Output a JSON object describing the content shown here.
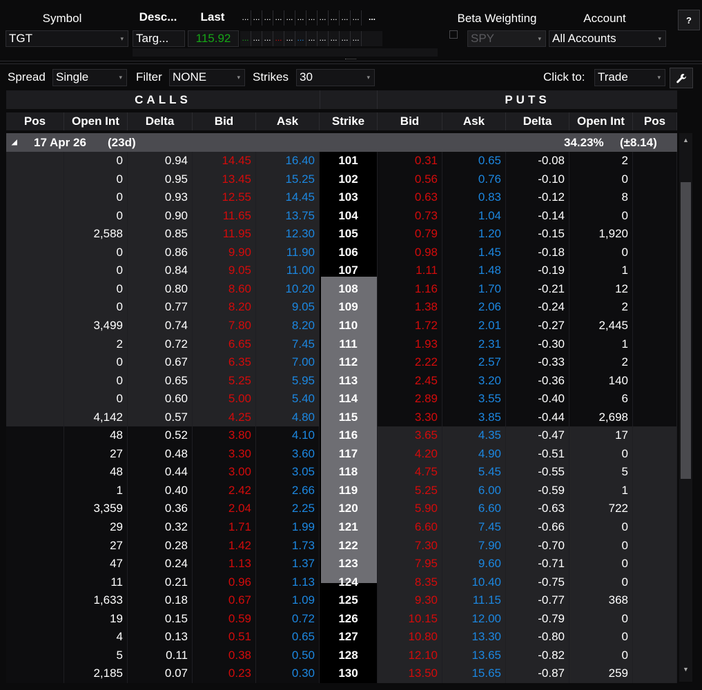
{
  "header": {
    "symbol_label": "Symbol",
    "symbol_value": "TGT",
    "desc_label": "Desc...",
    "desc_value": "Targ...",
    "last_label": "Last",
    "last_value": "115.92",
    "ellipsis": "...",
    "beta_label": "Beta Weighting",
    "beta_value": "SPY",
    "account_label": "Account",
    "account_value": "All Accounts",
    "help_label": "?"
  },
  "toolbar": {
    "spread_label": "Spread",
    "spread_value": "Single",
    "filter_label": "Filter",
    "filter_value": "NONE",
    "strikes_label": "Strikes",
    "strikes_value": "30",
    "clickto_label": "Click to:",
    "clickto_value": "Trade"
  },
  "sections": {
    "calls": "CALLS",
    "puts": "PUTS"
  },
  "columns": [
    "Pos",
    "Open Int",
    "Delta",
    "Bid",
    "Ask",
    "Strike",
    "Bid",
    "Ask",
    "Delta",
    "Open Int",
    "Pos"
  ],
  "expiry": {
    "date": "17 Apr 26",
    "dte": "(23d)",
    "iv": "34.23%",
    "move": "(±8.14)"
  },
  "rows": [
    {
      "coi": "0",
      "cdelta": "0.94",
      "cbid": "14.45",
      "cask": "16.40",
      "strike": "101",
      "pbid": "0.31",
      "pask": "0.65",
      "pdelta": "-0.08",
      "poi": "2"
    },
    {
      "coi": "0",
      "cdelta": "0.95",
      "cbid": "13.45",
      "cask": "15.25",
      "strike": "102",
      "pbid": "0.56",
      "pask": "0.76",
      "pdelta": "-0.10",
      "poi": "0"
    },
    {
      "coi": "0",
      "cdelta": "0.93",
      "cbid": "12.55",
      "cask": "14.45",
      "strike": "103",
      "pbid": "0.63",
      "pask": "0.83",
      "pdelta": "-0.12",
      "poi": "8"
    },
    {
      "coi": "0",
      "cdelta": "0.90",
      "cbid": "11.65",
      "cask": "13.75",
      "strike": "104",
      "pbid": "0.73",
      "pask": "1.04",
      "pdelta": "-0.14",
      "poi": "0"
    },
    {
      "coi": "2,588",
      "cdelta": "0.85",
      "cbid": "11.95",
      "cask": "12.30",
      "strike": "105",
      "pbid": "0.79",
      "pask": "1.20",
      "pdelta": "-0.15",
      "poi": "1,920"
    },
    {
      "coi": "0",
      "cdelta": "0.86",
      "cbid": "9.90",
      "cask": "11.90",
      "strike": "106",
      "pbid": "0.98",
      "pask": "1.45",
      "pdelta": "-0.18",
      "poi": "0"
    },
    {
      "coi": "0",
      "cdelta": "0.84",
      "cbid": "9.05",
      "cask": "11.00",
      "strike": "107",
      "pbid": "1.11",
      "pask": "1.48",
      "pdelta": "-0.19",
      "poi": "1"
    },
    {
      "coi": "0",
      "cdelta": "0.80",
      "cbid": "8.60",
      "cask": "10.20",
      "strike": "108",
      "pbid": "1.16",
      "pask": "1.70",
      "pdelta": "-0.21",
      "poi": "12"
    },
    {
      "coi": "0",
      "cdelta": "0.77",
      "cbid": "8.20",
      "cask": "9.05",
      "strike": "109",
      "pbid": "1.38",
      "pask": "2.06",
      "pdelta": "-0.24",
      "poi": "2"
    },
    {
      "coi": "3,499",
      "cdelta": "0.74",
      "cbid": "7.80",
      "cask": "8.20",
      "strike": "110",
      "pbid": "1.72",
      "pask": "2.01",
      "pdelta": "-0.27",
      "poi": "2,445"
    },
    {
      "coi": "2",
      "cdelta": "0.72",
      "cbid": "6.65",
      "cask": "7.45",
      "strike": "111",
      "pbid": "1.93",
      "pask": "2.31",
      "pdelta": "-0.30",
      "poi": "1"
    },
    {
      "coi": "0",
      "cdelta": "0.67",
      "cbid": "6.35",
      "cask": "7.00",
      "strike": "112",
      "pbid": "2.22",
      "pask": "2.57",
      "pdelta": "-0.33",
      "poi": "2"
    },
    {
      "coi": "0",
      "cdelta": "0.65",
      "cbid": "5.25",
      "cask": "5.95",
      "strike": "113",
      "pbid": "2.45",
      "pask": "3.20",
      "pdelta": "-0.36",
      "poi": "140"
    },
    {
      "coi": "0",
      "cdelta": "0.60",
      "cbid": "5.00",
      "cask": "5.40",
      "strike": "114",
      "pbid": "2.89",
      "pask": "3.55",
      "pdelta": "-0.40",
      "poi": "6"
    },
    {
      "coi": "4,142",
      "cdelta": "0.57",
      "cbid": "4.25",
      "cask": "4.80",
      "strike": "115",
      "pbid": "3.30",
      "pask": "3.85",
      "pdelta": "-0.44",
      "poi": "2,698"
    },
    {
      "coi": "48",
      "cdelta": "0.52",
      "cbid": "3.80",
      "cask": "4.10",
      "strike": "116",
      "pbid": "3.65",
      "pask": "4.35",
      "pdelta": "-0.47",
      "poi": "17"
    },
    {
      "coi": "27",
      "cdelta": "0.48",
      "cbid": "3.30",
      "cask": "3.60",
      "strike": "117",
      "pbid": "4.20",
      "pask": "4.90",
      "pdelta": "-0.51",
      "poi": "0"
    },
    {
      "coi": "48",
      "cdelta": "0.44",
      "cbid": "3.00",
      "cask": "3.05",
      "strike": "118",
      "pbid": "4.75",
      "pask": "5.45",
      "pdelta": "-0.55",
      "poi": "5"
    },
    {
      "coi": "1",
      "cdelta": "0.40",
      "cbid": "2.42",
      "cask": "2.66",
      "strike": "119",
      "pbid": "5.25",
      "pask": "6.00",
      "pdelta": "-0.59",
      "poi": "1"
    },
    {
      "coi": "3,359",
      "cdelta": "0.36",
      "cbid": "2.04",
      "cask": "2.25",
      "strike": "120",
      "pbid": "5.90",
      "pask": "6.60",
      "pdelta": "-0.63",
      "poi": "722"
    },
    {
      "coi": "29",
      "cdelta": "0.32",
      "cbid": "1.71",
      "cask": "1.99",
      "strike": "121",
      "pbid": "6.60",
      "pask": "7.45",
      "pdelta": "-0.66",
      "poi": "0"
    },
    {
      "coi": "27",
      "cdelta": "0.28",
      "cbid": "1.42",
      "cask": "1.73",
      "strike": "122",
      "pbid": "7.30",
      "pask": "7.90",
      "pdelta": "-0.70",
      "poi": "0"
    },
    {
      "coi": "47",
      "cdelta": "0.24",
      "cbid": "1.13",
      "cask": "1.37",
      "strike": "123",
      "pbid": "7.95",
      "pask": "9.60",
      "pdelta": "-0.71",
      "poi": "0"
    },
    {
      "coi": "11",
      "cdelta": "0.21",
      "cbid": "0.96",
      "cask": "1.13",
      "strike": "124",
      "pbid": "8.35",
      "pask": "10.40",
      "pdelta": "-0.75",
      "poi": "0"
    },
    {
      "coi": "1,633",
      "cdelta": "0.18",
      "cbid": "0.67",
      "cask": "1.09",
      "strike": "125",
      "pbid": "9.30",
      "pask": "11.15",
      "pdelta": "-0.77",
      "poi": "368"
    },
    {
      "coi": "19",
      "cdelta": "0.15",
      "cbid": "0.59",
      "cask": "0.72",
      "strike": "126",
      "pbid": "10.15",
      "pask": "12.00",
      "pdelta": "-0.79",
      "poi": "0"
    },
    {
      "coi": "4",
      "cdelta": "0.13",
      "cbid": "0.51",
      "cask": "0.65",
      "strike": "127",
      "pbid": "10.80",
      "pask": "13.30",
      "pdelta": "-0.80",
      "poi": "0"
    },
    {
      "coi": "5",
      "cdelta": "0.11",
      "cbid": "0.38",
      "cask": "0.50",
      "strike": "128",
      "pbid": "12.10",
      "pask": "13.65",
      "pdelta": "-0.82",
      "poi": "0"
    },
    {
      "coi": "2,185",
      "cdelta": "0.07",
      "cbid": "0.23",
      "cask": "0.30",
      "strike": "130",
      "pbid": "13.50",
      "pask": "15.65",
      "pdelta": "-0.87",
      "poi": "259"
    }
  ],
  "itm_calls_count": 15,
  "itm_puts_start": 15,
  "highlight_strike_range": [
    "108",
    "124"
  ],
  "colors": {
    "bid": "#d30b0b",
    "ask": "#1c87e0",
    "last": "#16a516",
    "itm_bg": "#232326",
    "otm_bg": "#0d0d0f",
    "strike_bg": "#000000",
    "strike_highlight": "#6e6e73"
  }
}
